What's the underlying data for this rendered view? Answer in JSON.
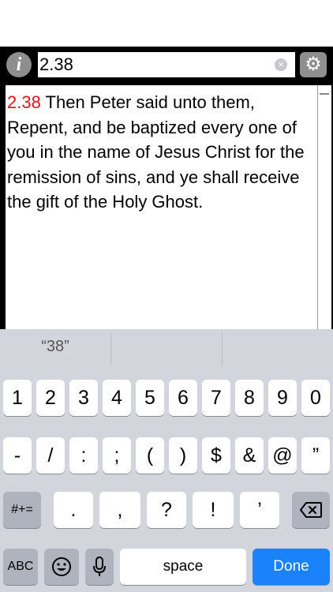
{
  "toolbar": {
    "info_icon": "i",
    "search_value": "2.38",
    "clear_icon": "×",
    "settings_icon": "⚙"
  },
  "verse": {
    "reference": "2.38",
    "text": " Then Peter said unto them, Repent, and be baptized every one of you in the name of Jesus Christ for the remission of sins, and ye shall receive the gift of the Holy Ghost."
  },
  "keyboard": {
    "suggestions": [
      "“38”",
      "",
      ""
    ],
    "row1": [
      "1",
      "2",
      "3",
      "4",
      "5",
      "6",
      "7",
      "8",
      "9",
      "0"
    ],
    "row2": [
      "-",
      "/",
      ":",
      ";",
      "(",
      ")",
      "$",
      "&",
      "@",
      "”"
    ],
    "row3": {
      "shift_label": "#+=",
      "keys": [
        ".",
        ",",
        "?",
        "!",
        "’"
      ],
      "delete_icon": "backspace-icon"
    },
    "row4": {
      "abc_label": "ABC",
      "emoji_icon": "emoji-icon",
      "mic_icon": "microphone-icon",
      "space_label": "space",
      "done_label": "Done"
    }
  },
  "colors": {
    "verse_ref": "#e0131a",
    "done_key": "#1a82fb",
    "keyboard_bg": "#d2d5db"
  }
}
